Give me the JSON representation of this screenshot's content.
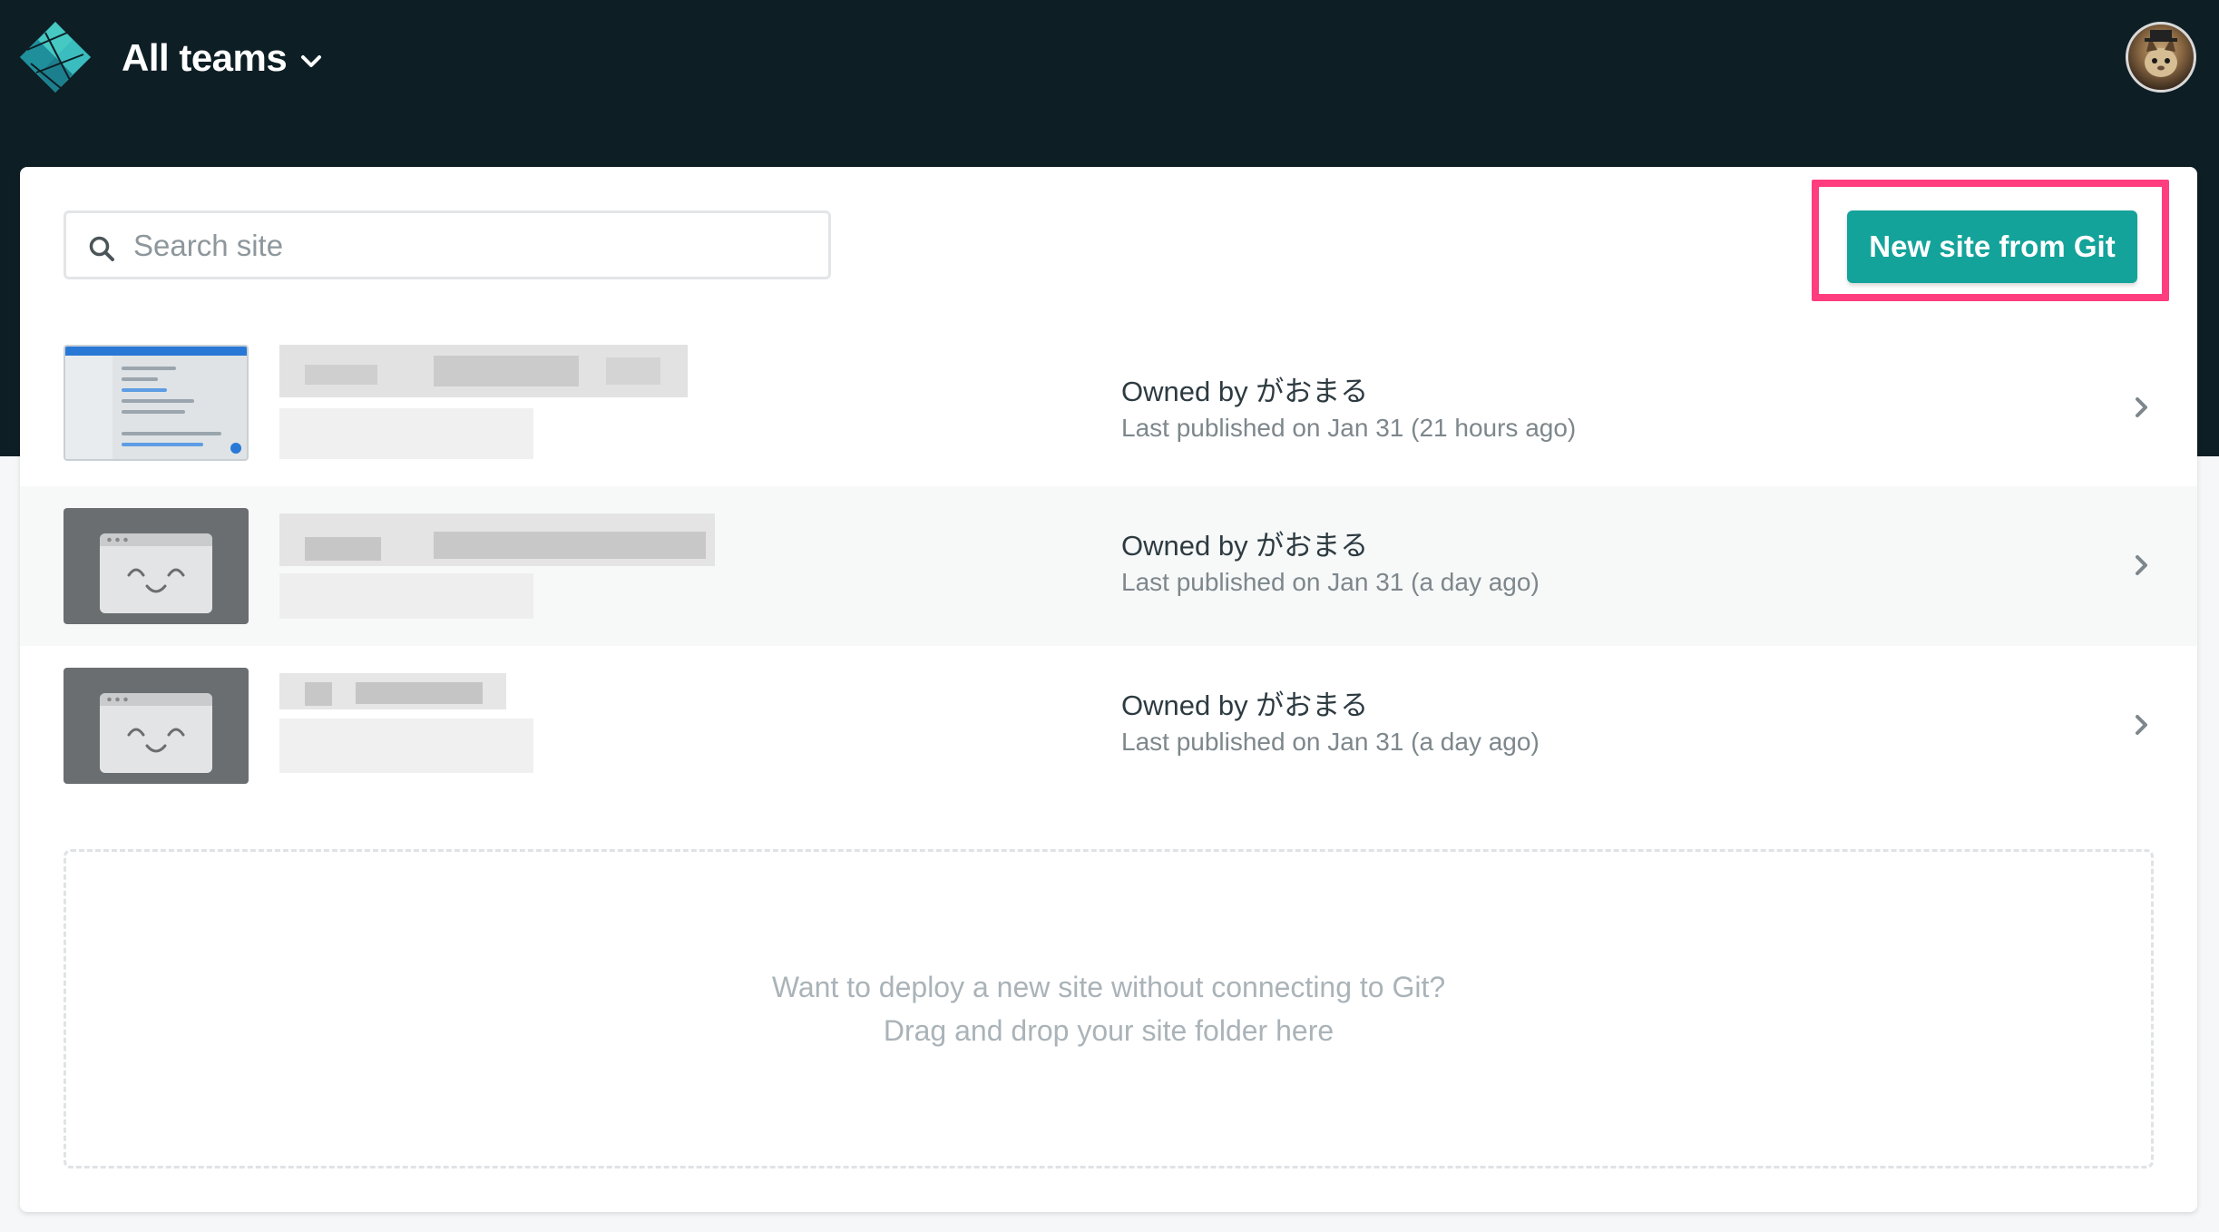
{
  "header": {
    "team_label": "All teams",
    "logo_icon": "netlify-logo-icon",
    "avatar_icon": "user-avatar"
  },
  "search": {
    "placeholder": "Search site"
  },
  "actions": {
    "new_site_label": "New site from Git"
  },
  "sites": [
    {
      "owner": "Owned by がおまる",
      "published": "Last published on Jan 31 (21 hours ago)",
      "thumbnail": "screenshot"
    },
    {
      "owner": "Owned by がおまる",
      "published": "Last published on Jan 31 (a day ago)",
      "thumbnail": "placeholder"
    },
    {
      "owner": "Owned by がおまる",
      "published": "Last published on Jan 31 (a day ago)",
      "thumbnail": "placeholder"
    }
  ],
  "dropzone": {
    "line1": "Want to deploy a new site without connecting to Git?",
    "line2": "Drag and drop your site folder here"
  },
  "colors": {
    "header_bg": "#0e1e25",
    "accent": "#14a39a",
    "highlight": "#ff3d7f"
  }
}
